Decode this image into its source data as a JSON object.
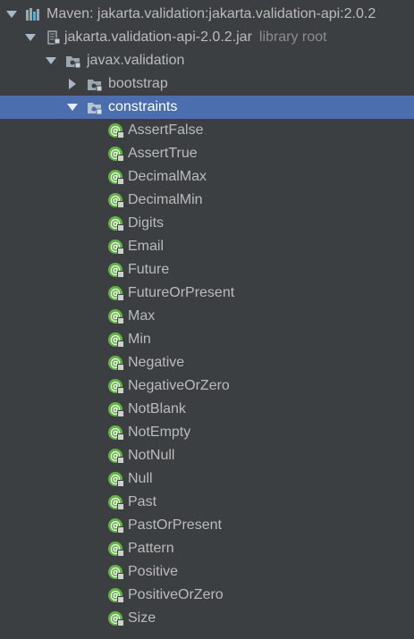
{
  "tree": {
    "maven_root": {
      "label": "Maven: jakarta.validation:jakarta.validation-api:2.0.2",
      "icon": "maven-library-icon"
    },
    "jar": {
      "label": "jakarta.validation-api-2.0.2.jar",
      "secondary": "library root",
      "icon": "jar-icon"
    },
    "package": {
      "label": "javax.validation",
      "icon": "package-icon"
    },
    "bootstrap": {
      "label": "bootstrap",
      "icon": "package-icon"
    },
    "constraints": {
      "label": "constraints",
      "icon": "package-icon",
      "selected": true
    },
    "annotations": [
      {
        "label": "AssertFalse",
        "icon_text": "@"
      },
      {
        "label": "AssertTrue",
        "icon_text": "@"
      },
      {
        "label": "DecimalMax",
        "icon_text": "@"
      },
      {
        "label": "DecimalMin",
        "icon_text": "@"
      },
      {
        "label": "Digits",
        "icon_text": "@"
      },
      {
        "label": "Email",
        "icon_text": "@"
      },
      {
        "label": "Future",
        "icon_text": "@"
      },
      {
        "label": "FutureOrPresent",
        "icon_text": "@"
      },
      {
        "label": "Max",
        "icon_text": "@"
      },
      {
        "label": "Min",
        "icon_text": "@"
      },
      {
        "label": "Negative",
        "icon_text": "@"
      },
      {
        "label": "NegativeOrZero",
        "icon_text": "@"
      },
      {
        "label": "NotBlank",
        "icon_text": "@"
      },
      {
        "label": "NotEmpty",
        "icon_text": "@"
      },
      {
        "label": "NotNull",
        "icon_text": "@"
      },
      {
        "label": "Null",
        "icon_text": "@"
      },
      {
        "label": "Past",
        "icon_text": "@"
      },
      {
        "label": "PastOrPresent",
        "icon_text": "@"
      },
      {
        "label": "Pattern",
        "icon_text": "@"
      },
      {
        "label": "Positive",
        "icon_text": "@"
      },
      {
        "label": "PositiveOrZero",
        "icon_text": "@"
      },
      {
        "label": "Size",
        "icon_text": "@"
      }
    ],
    "colors": {
      "background": "#3c3f41",
      "selection": "#4b6eaf",
      "text": "#bbbbbb",
      "secondary_text": "#8c8c8c",
      "annotation_green": "#62b543"
    }
  }
}
